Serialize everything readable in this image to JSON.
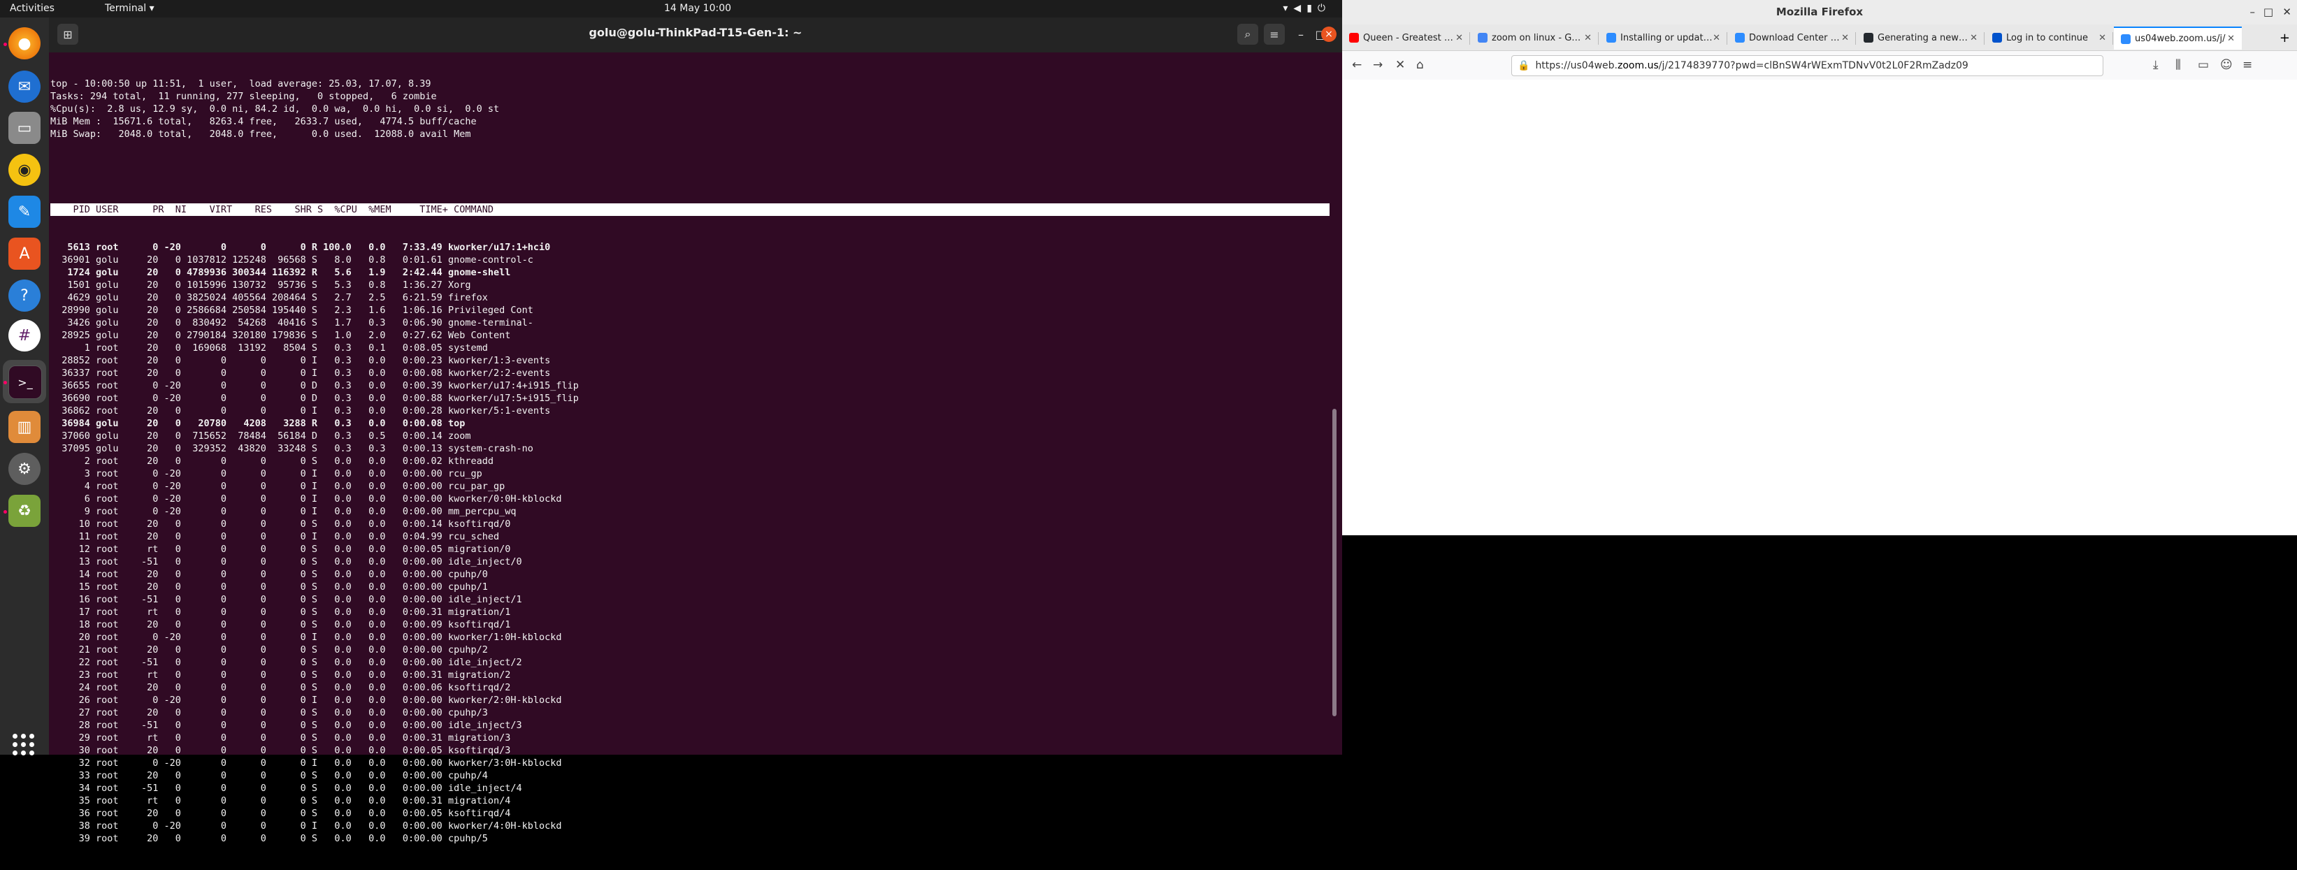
{
  "topbar": {
    "activities": "Activities",
    "app_menu": "Terminal ▾",
    "clock": "14 May  10:00"
  },
  "dock": {
    "apps": [
      "firefox-icon",
      "thunderbird-icon",
      "files-icon",
      "rhythmbox-icon",
      "writer-icon",
      "software-icon",
      "help-icon",
      "slack-icon",
      "terminal-icon",
      "archive-icon",
      "settings-icon",
      "trash-icon"
    ]
  },
  "terminal": {
    "title": "golu@golu-ThinkPad-T15-Gen-1: ~",
    "summary": [
      "top - 10:00:50 up 11:51,  1 user,  load average: 25.03, 17.07, 8.39",
      "Tasks: 294 total,  11 running, 277 sleeping,   0 stopped,   6 zombie",
      "%Cpu(s):  2.8 us, 12.9 sy,  0.0 ni, 84.2 id,  0.0 wa,  0.0 hi,  0.0 si,  0.0 st",
      "MiB Mem :  15671.6 total,   8263.4 free,   2633.7 used,   4774.5 buff/cache",
      "MiB Swap:   2048.0 total,   2048.0 free,      0.0 used.  12088.0 avail Mem"
    ],
    "header": "    PID USER      PR  NI    VIRT    RES    SHR S  %CPU  %MEM     TIME+ COMMAND",
    "rows": [
      {
        "t": "   5613 root      0 -20       0      0      0 R 100.0   0.0   7:33.49 kworker/u17:1+hci0",
        "b": true
      },
      {
        "t": "  36901 golu     20   0 1037812 125248  96568 S   8.0   0.8   0:01.61 gnome-control-c",
        "b": false
      },
      {
        "t": "   1724 golu     20   0 4789936 300344 116392 R   5.6   1.9   2:42.44 gnome-shell",
        "b": true
      },
      {
        "t": "   1501 golu     20   0 1015996 130732  95736 S   5.3   0.8   1:36.27 Xorg",
        "b": false
      },
      {
        "t": "   4629 golu     20   0 3825024 405564 208464 S   2.7   2.5   6:21.59 firefox",
        "b": false
      },
      {
        "t": "  28990 golu     20   0 2586684 250584 195440 S   2.3   1.6   1:06.16 Privileged Cont",
        "b": false
      },
      {
        "t": "   3426 golu     20   0  830492  54268  40416 S   1.7   0.3   0:06.90 gnome-terminal-",
        "b": false
      },
      {
        "t": "  28925 golu     20   0 2790184 320180 179836 S   1.0   2.0   0:27.62 Web Content",
        "b": false
      },
      {
        "t": "      1 root     20   0  169068  13192   8504 S   0.3   0.1   0:08.05 systemd",
        "b": false
      },
      {
        "t": "  28852 root     20   0       0      0      0 I   0.3   0.0   0:00.23 kworker/1:3-events",
        "b": false
      },
      {
        "t": "  36337 root     20   0       0      0      0 I   0.3   0.0   0:00.08 kworker/2:2-events",
        "b": false
      },
      {
        "t": "  36655 root      0 -20       0      0      0 D   0.3   0.0   0:00.39 kworker/u17:4+i915_flip",
        "b": false
      },
      {
        "t": "  36690 root      0 -20       0      0      0 D   0.3   0.0   0:00.88 kworker/u17:5+i915_flip",
        "b": false
      },
      {
        "t": "  36862 root     20   0       0      0      0 I   0.3   0.0   0:00.28 kworker/5:1-events",
        "b": false
      },
      {
        "t": "  36984 golu     20   0   20780   4208   3288 R   0.3   0.0   0:00.08 top",
        "b": true
      },
      {
        "t": "  37060 golu     20   0  715652  78484  56184 D   0.3   0.5   0:00.14 zoom",
        "b": false
      },
      {
        "t": "  37095 golu     20   0  329352  43820  33248 S   0.3   0.3   0:00.13 system-crash-no",
        "b": false
      },
      {
        "t": "      2 root     20   0       0      0      0 S   0.0   0.0   0:00.02 kthreadd",
        "b": false
      },
      {
        "t": "      3 root      0 -20       0      0      0 I   0.0   0.0   0:00.00 rcu_gp",
        "b": false
      },
      {
        "t": "      4 root      0 -20       0      0      0 I   0.0   0.0   0:00.00 rcu_par_gp",
        "b": false
      },
      {
        "t": "      6 root      0 -20       0      0      0 I   0.0   0.0   0:00.00 kworker/0:0H-kblockd",
        "b": false
      },
      {
        "t": "      9 root      0 -20       0      0      0 I   0.0   0.0   0:00.00 mm_percpu_wq",
        "b": false
      },
      {
        "t": "     10 root     20   0       0      0      0 S   0.0   0.0   0:00.14 ksoftirqd/0",
        "b": false
      },
      {
        "t": "     11 root     20   0       0      0      0 I   0.0   0.0   0:04.99 rcu_sched",
        "b": false
      },
      {
        "t": "     12 root     rt   0       0      0      0 S   0.0   0.0   0:00.05 migration/0",
        "b": false
      },
      {
        "t": "     13 root    -51   0       0      0      0 S   0.0   0.0   0:00.00 idle_inject/0",
        "b": false
      },
      {
        "t": "     14 root     20   0       0      0      0 S   0.0   0.0   0:00.00 cpuhp/0",
        "b": false
      },
      {
        "t": "     15 root     20   0       0      0      0 S   0.0   0.0   0:00.00 cpuhp/1",
        "b": false
      },
      {
        "t": "     16 root    -51   0       0      0      0 S   0.0   0.0   0:00.00 idle_inject/1",
        "b": false
      },
      {
        "t": "     17 root     rt   0       0      0      0 S   0.0   0.0   0:00.31 migration/1",
        "b": false
      },
      {
        "t": "     18 root     20   0       0      0      0 S   0.0   0.0   0:00.09 ksoftirqd/1",
        "b": false
      },
      {
        "t": "     20 root      0 -20       0      0      0 I   0.0   0.0   0:00.00 kworker/1:0H-kblockd",
        "b": false
      },
      {
        "t": "     21 root     20   0       0      0      0 S   0.0   0.0   0:00.00 cpuhp/2",
        "b": false
      },
      {
        "t": "     22 root    -51   0       0      0      0 S   0.0   0.0   0:00.00 idle_inject/2",
        "b": false
      },
      {
        "t": "     23 root     rt   0       0      0      0 S   0.0   0.0   0:00.31 migration/2",
        "b": false
      },
      {
        "t": "     24 root     20   0       0      0      0 S   0.0   0.0   0:00.06 ksoftirqd/2",
        "b": false
      },
      {
        "t": "     26 root      0 -20       0      0      0 I   0.0   0.0   0:00.00 kworker/2:0H-kblockd",
        "b": false
      },
      {
        "t": "     27 root     20   0       0      0      0 S   0.0   0.0   0:00.00 cpuhp/3",
        "b": false
      },
      {
        "t": "     28 root    -51   0       0      0      0 S   0.0   0.0   0:00.00 idle_inject/3",
        "b": false
      },
      {
        "t": "     29 root     rt   0       0      0      0 S   0.0   0.0   0:00.31 migration/3",
        "b": false
      },
      {
        "t": "     30 root     20   0       0      0      0 S   0.0   0.0   0:00.05 ksoftirqd/3",
        "b": false
      },
      {
        "t": "     32 root      0 -20       0      0      0 I   0.0   0.0   0:00.00 kworker/3:0H-kblockd",
        "b": false
      },
      {
        "t": "     33 root     20   0       0      0      0 S   0.0   0.0   0:00.00 cpuhp/4",
        "b": false
      },
      {
        "t": "     34 root    -51   0       0      0      0 S   0.0   0.0   0:00.00 idle_inject/4",
        "b": false
      },
      {
        "t": "     35 root     rt   0       0      0      0 S   0.0   0.0   0:00.31 migration/4",
        "b": false
      },
      {
        "t": "     36 root     20   0       0      0      0 S   0.0   0.0   0:00.05 ksoftirqd/4",
        "b": false
      },
      {
        "t": "     38 root      0 -20       0      0      0 I   0.0   0.0   0:00.00 kworker/4:0H-kblockd",
        "b": false
      },
      {
        "t": "     39 root     20   0       0      0      0 S   0.0   0.0   0:00.00 cpuhp/5",
        "b": false
      }
    ]
  },
  "firefox": {
    "title": "Mozilla Firefox",
    "tabs": [
      {
        "label": "Queen - Greatest Hits",
        "color": "#ff0000"
      },
      {
        "label": "zoom on linux - Google Search",
        "color": "#4285f4"
      },
      {
        "label": "Installing or updating Zoom",
        "color": "#2d8cff"
      },
      {
        "label": "Download Center - Zoom",
        "color": "#2d8cff"
      },
      {
        "label": "Generating a new SSH key",
        "color": "#24292e"
      },
      {
        "label": "Log in to continue",
        "color": "#0052cc"
      },
      {
        "label": "us04web.zoom.us/j/",
        "color": "#2d8cff",
        "active": true
      }
    ],
    "url_prefix": "https://us04web.",
    "url_domain": "zoom.us",
    "url_rest": "/j/2174839770?pwd=clBnSW4rWExmTDNvV0t2L0F2RmZadz09"
  },
  "colors": {
    "terminal_bg": "#300a24",
    "accent": "#e95420",
    "firefox_tab_accent": "#0a84ff"
  }
}
